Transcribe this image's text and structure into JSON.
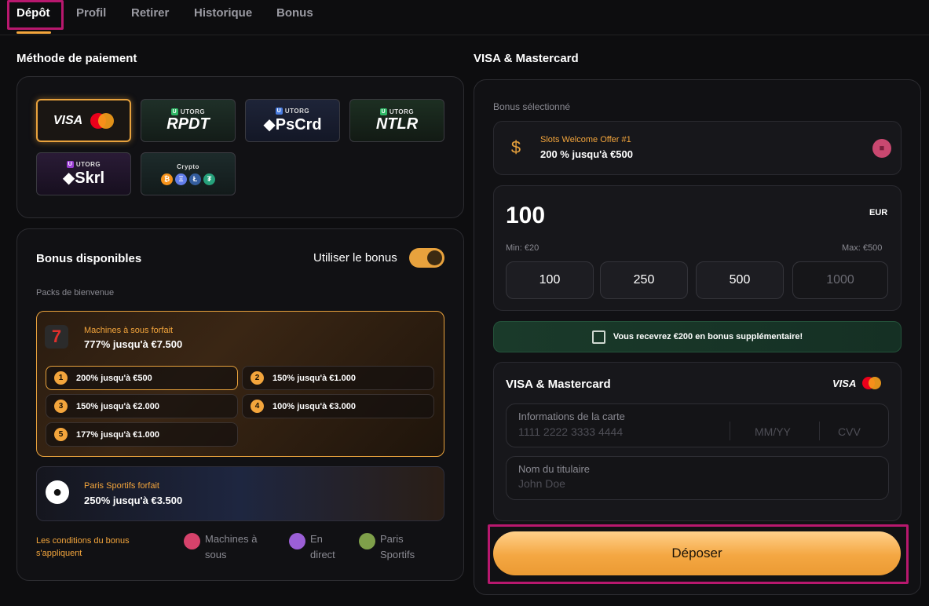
{
  "tabs": [
    "Dépôt",
    "Profil",
    "Retirer",
    "Historique",
    "Bonus"
  ],
  "payment_method": {
    "title": "Méthode de paiement",
    "utorg_label": "UTORG",
    "visa_label": "VISA",
    "methods": [
      "RPDT",
      "PsCrd",
      "NTLR",
      "Skrl"
    ],
    "crypto_label": "Crypto",
    "crypto_coins": [
      "₿",
      "Ξ",
      "Ł",
      "₮"
    ]
  },
  "bonus": {
    "title": "Bonus disponibles",
    "use_bonus_label": "Utiliser le bonus",
    "toggle_on": true,
    "packs_label": "Packs de bienvenue",
    "slots": {
      "subtitle": "Machines à sous forfait",
      "main": "777% jusqu'à €7.500",
      "tiers": [
        {
          "num": "1",
          "label": "200% jusqu'à €500"
        },
        {
          "num": "2",
          "label": "150% jusqu'à €1.000"
        },
        {
          "num": "3",
          "label": "150% jusqu'à €2.000"
        },
        {
          "num": "4",
          "label": "100% jusqu'à €3.000"
        },
        {
          "num": "5",
          "label": "177% jusqu'à €1.000"
        }
      ]
    },
    "sports": {
      "subtitle": "Paris Sportifs forfait",
      "main": "250% jusqu'à €3.500"
    },
    "conditions": "Les conditions du bonus s'appliquent",
    "categories": [
      {
        "line1": "Machines à",
        "line2": "sous",
        "color": "#d6426b"
      },
      {
        "line1": "En",
        "line2": "direct",
        "color": "#9b5fd6"
      },
      {
        "line1": "Paris",
        "line2": "Sportifs",
        "color": "#7fa04a"
      }
    ]
  },
  "right": {
    "title": "VISA & Mastercard",
    "selected_bonus_label": "Bonus sélectionné",
    "selected_offer_sub": "Slots Welcome Offer #1",
    "selected_offer_main": "200 % jusqu'à €500",
    "amount": "100",
    "currency": "EUR",
    "min": "Min: €20",
    "max": "Max: €500",
    "presets": [
      "100",
      "250",
      "500",
      "1000"
    ],
    "promo": "Vous recevrez €200 en bonus supplémentaire!",
    "card_title": "VISA & Mastercard",
    "card_visa": "VISA",
    "card_info_label": "Informations de la carte",
    "card_number_ph": "1111 2222 3333 4444",
    "expiry_ph": "MM/YY",
    "cvv_ph": "CVV",
    "holder_label": "Nom du titulaire",
    "holder_ph": "John Doe",
    "deposit_label": "Déposer"
  },
  "colors": {
    "accent": "#f3a53c",
    "highlight": "#b8186e",
    "background": "#0d0d0f"
  }
}
